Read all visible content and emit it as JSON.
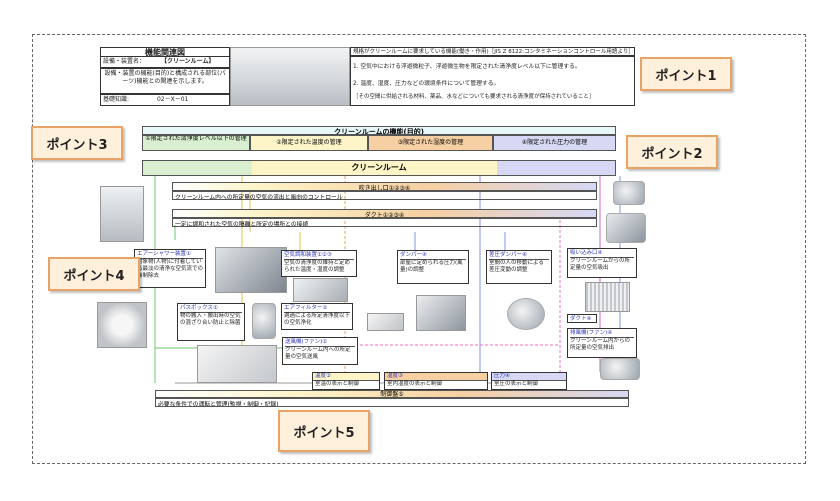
{
  "header": {
    "title": "機能関連図",
    "equipment_label": "設備・装置名：",
    "equipment_name": "【クリーンルーム】",
    "description": "設備・装置の機能(目的)と構成される部位(パーツ)機能との関連を示します。",
    "basic_knowledge_label": "基礎知識:",
    "basic_knowledge_code": "02－X－01",
    "spec_line": "規格がクリーンルームに要求している機能(働き・作用)［JIS Z 8122:コンタミネーションコントロール用語より］",
    "item1": "1. 空気中における浮遊微粒子、浮遊微生物を限定された清浄度レベル以下に管理する。",
    "item2": "2. 温度、湿度、圧力などの環境条件について管理する。",
    "note": "［その空間に供給される材料、薬品、水などについても要求される清浄度が保持されていること］"
  },
  "purpose": {
    "title": "クリーンルームの機能(目的)",
    "c1": "①限定された清浄度レベル以下の管理",
    "c2": "②限定された温度の管理",
    "c3": "③限定された湿度の管理",
    "c4": "④限定された圧力の管理"
  },
  "cleanroom_label": "クリーンルーム",
  "blowout": {
    "title": "吹き出し口①②③④",
    "desc": "クリーンルーム内への所定量の空気の流出と風向のコントロール"
  },
  "duct": {
    "title": "ダクト①②③④",
    "desc": "一定に調和された空気の隔離と所定の場所との接続"
  },
  "air_shower": {
    "title": "エアーシャワー装置①",
    "desc": "対象物(人物)に付着している最淡の清浄な空気流での強制除去"
  },
  "ahu": {
    "title": "空気調和装置①②③",
    "desc": "空気の清浄度の維持と定められた温度・湿度の調整"
  },
  "damper": {
    "title": "ダンパー④",
    "desc": "部屋に定められる圧力(風量)の調整"
  },
  "diff_damper": {
    "title": "差圧ダンパー④",
    "desc": "室間の人の移動による差圧変動の調整"
  },
  "intake": {
    "title": "吸い込み口④",
    "desc": "クリーンルームからの所定量の空気吸出"
  },
  "duct4": "ダクト④",
  "exhaust": {
    "title": "排風機(ファン)④",
    "desc": "クリーンルーム内からの所定量の空気排出"
  },
  "pass_box": {
    "title": "パスボックス①",
    "desc": "物の搬入・搬出時の空気の混ざり合い防止と除菌"
  },
  "air_filter": {
    "title": "エアフィルター①",
    "desc": "適過による所定清浄度以下の空気浄化"
  },
  "supply_fan": {
    "title": "送風機(ファン)①",
    "desc": "クリーンルーム内への所定量の空気送風"
  },
  "bottom": {
    "temp_title": "温度②",
    "temp_desc": "室温の表示と制御",
    "humid_title": "湿度③",
    "humid_desc": "室内湿度の表示と制御",
    "press_title": "圧力④",
    "press_desc": "室圧の表示と制御",
    "control_panel": "制御盤⑤",
    "control_desc": "必要な条件での運転と管理(監視・制御・記録)"
  },
  "points": [
    "ポイント1",
    "ポイント2",
    "ポイント3",
    "ポイント4",
    "ポイント5"
  ],
  "colors": {
    "col1": "#d8f0d0",
    "col2": "#fdf5c8",
    "col3": "#f6cfa2",
    "col4": "#d6d8f4",
    "point_fill": "#fff0dc",
    "point_border": "#e8a468"
  }
}
